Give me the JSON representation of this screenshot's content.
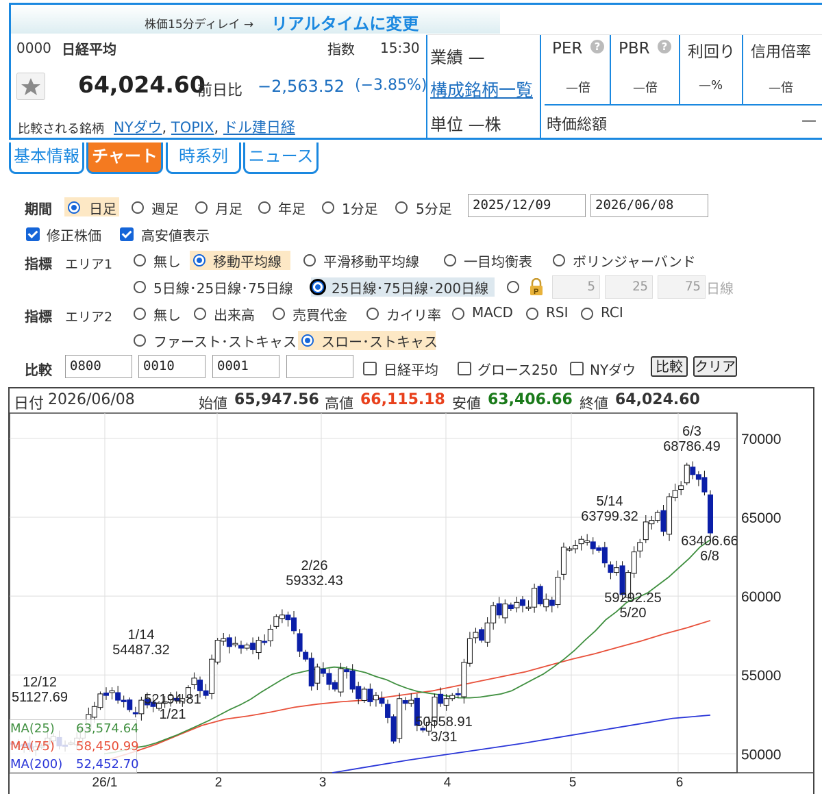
{
  "header": {
    "delay_notice": "株価15分ディレイ →",
    "realtime_link": "リアルタイムに変更",
    "code": "0000",
    "name": "日経平均",
    "kind": "指数",
    "time": "15:30",
    "price": "64,024.60",
    "change_label": "前日比",
    "change": "−2,563.52",
    "change_pct": "(−3.85%)",
    "compare_label": "比較される銘柄",
    "compare_links": [
      "NYダウ",
      "TOPIX",
      "ドル建日経"
    ],
    "gyoseki": "業績 —",
    "constituents_link": "構成銘柄一覧",
    "unit": "単位 —株",
    "metrics": [
      {
        "label": "PER",
        "value": "—倍",
        "help": true
      },
      {
        "label": "PBR",
        "value": "—倍",
        "help": true
      },
      {
        "label": "利回り",
        "value": "—%",
        "help": false
      },
      {
        "label": "信用倍率",
        "value": "—倍",
        "help": false
      }
    ],
    "market_cap_label": "時価総額",
    "market_cap_value": "—",
    "star_icon": "star-icon"
  },
  "tabs": [
    "基本情報",
    "チャート",
    "時系列",
    "ニュース"
  ],
  "active_tab": "チャート",
  "controls": {
    "period_label": "期間",
    "period_options": [
      "日足",
      "週足",
      "月足",
      "年足",
      "1分足",
      "5分足"
    ],
    "period_selected": "日足",
    "date_from": "2025/12/09",
    "date_to": "2026/06/08",
    "adjusted_label": "修正株価",
    "hilo_label": "高安値表示",
    "ind1_label": "指標",
    "area1_label": "エリア1",
    "area1_options": [
      "無し",
      "移動平均線",
      "平滑移動平均線",
      "一目均衡表",
      "ボリンジャーバンド"
    ],
    "area1_selected": "移動平均線",
    "ma_option1": "5日線･25日線･75日線",
    "ma_option2": "25日線･75日線･200日線",
    "ma_custom": [
      "5",
      "25",
      "75"
    ],
    "ma_custom_unit": "日線",
    "ind2_label": "指標",
    "area2_label": "エリア2",
    "area2_options": [
      "無し",
      "出来高",
      "売買代金",
      "カイリ率",
      "MACD",
      "RSI",
      "RCI"
    ],
    "area2_options_row2": [
      "ファースト･ストキャス",
      "スロー･ストキャス"
    ],
    "area2_selected": "スロー･ストキャス",
    "compare_label": "比較",
    "compare_inputs": [
      "0800",
      "0010",
      "0001",
      ""
    ],
    "compare_checks": [
      "日経平均",
      "グロース250",
      "NYダウ"
    ],
    "compare_button": "比較",
    "clear_button": "クリア"
  },
  "chart_info": {
    "date_label": "日付",
    "date": "2026/06/08",
    "open_label": "始値",
    "open": "65,947.56",
    "high_label": "高値",
    "high": "66,115.18",
    "low_label": "安値",
    "low": "63,406.66",
    "close_label": "終値",
    "close": "64,024.60",
    "colors": {
      "high": "#e8401c",
      "low": "#1a7a1a",
      "up": "#ffffff",
      "down": "#0b1fa8"
    }
  },
  "legend": [
    {
      "label": "MA(25)",
      "value": "63,574.64",
      "color": "#3f8f3f"
    },
    {
      "label": "MA(75)",
      "value": "58,450.99",
      "color": "#e8503a"
    },
    {
      "label": "MA(200)",
      "value": "52,452.70",
      "color": "#2a36d8"
    }
  ],
  "chart_data": {
    "type": "candlestick",
    "y_ticks": [
      "70000",
      "65000",
      "60000",
      "55000",
      "50000"
    ],
    "ylim": [
      48800,
      71600
    ],
    "x_ticks": [
      "26/1",
      "2",
      "3",
      "4",
      "5",
      "6"
    ],
    "annotations": [
      {
        "date": "12/12",
        "value": "51127.69"
      },
      {
        "date": "1/14",
        "value": "54487.32"
      },
      {
        "date": "1/21",
        "value": "52194.81"
      },
      {
        "date": "2/26",
        "value": "59332.43"
      },
      {
        "date": "3/31",
        "value": "50558.91"
      },
      {
        "date": "5/14",
        "value": "63799.32"
      },
      {
        "date": "5/20",
        "value": "59292.25"
      },
      {
        "date": "6/3",
        "value": "68786.49"
      },
      {
        "date": "6/8",
        "value": "63406.66"
      }
    ],
    "close_series": [
      50600,
      50550,
      50500,
      50350,
      50450,
      50500,
      51000,
      51100,
      50500,
      50500,
      50700,
      51000,
      51500,
      52500,
      53000,
      53800,
      53700,
      54000,
      53400,
      53300,
      52800,
      52600,
      53400,
      53100,
      53000,
      53200,
      53300,
      53700,
      53400,
      53500,
      54200,
      54800,
      54000,
      53700,
      56000,
      57200,
      57300,
      56800,
      57000,
      56700,
      56900,
      56600,
      57200,
      57100,
      57900,
      58700,
      58800,
      58500,
      57800,
      56500,
      56000,
      54300,
      55500,
      55100,
      54400,
      54100,
      55400,
      55200,
      54100,
      53500,
      54100,
      53300,
      53700,
      53200,
      52300,
      50800,
      53500,
      53200,
      53400,
      51800,
      51500,
      52000,
      53600,
      53200,
      53500,
      53700,
      53800,
      55800,
      57300,
      57700,
      57200,
      58300,
      59400,
      58800,
      59500,
      59200,
      59600,
      59400,
      59300,
      60500,
      59500,
      59800,
      59400,
      61200,
      63100,
      63000,
      63200,
      63600,
      63500,
      63000,
      62900,
      62100,
      61500,
      61800,
      60100,
      61500,
      62800,
      63400,
      64700,
      64800,
      65300,
      64100,
      66300,
      66700,
      67000,
      68300,
      67700,
      67400,
      66600,
      64000
    ],
    "ma25_series": [
      50000,
      50100,
      50250,
      50400,
      50500,
      50700,
      50950,
      51200,
      51500,
      51800,
      52100,
      52450,
      52800,
      53100,
      53450,
      53900,
      54300,
      54700,
      55050,
      55200,
      55350,
      55400,
      55500,
      55450,
      55300,
      55150,
      54900,
      54700,
      54400,
      54150,
      53950,
      53850,
      53750,
      53650,
      53550,
      53550,
      53600,
      53700,
      53800,
      54000,
      54350,
      54700,
      55050,
      55500,
      56000,
      56550,
      57200,
      57800,
      58500,
      59000,
      59600,
      59900,
      60200,
      60700,
      61200,
      61800,
      62400,
      63100,
      63574
    ],
    "ma75_series": [
      49650,
      50100,
      50600,
      51200,
      51800,
      52200,
      52400,
      52650,
      52950,
      53150,
      53300,
      53400,
      53600,
      53800,
      54000,
      54300,
      54600,
      54900,
      55200,
      55600,
      56000,
      56350,
      56750,
      57150,
      57600,
      58000,
      58450
    ],
    "ma200_series": [
      48800,
      49200,
      49600,
      49950,
      50300,
      50650,
      51050,
      51450,
      51850,
      52250,
      52452
    ]
  }
}
